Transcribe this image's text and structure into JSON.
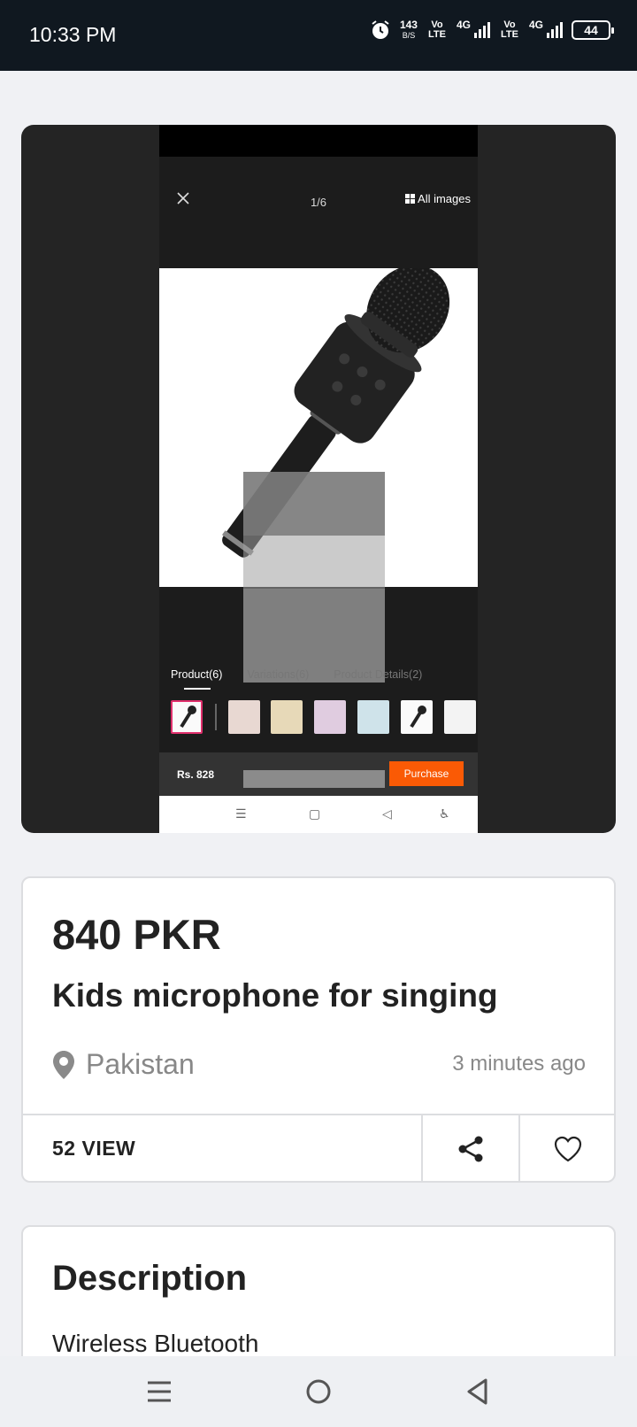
{
  "status_bar": {
    "time": "10:33 PM",
    "net_speed": "143",
    "net_speed_unit": "B/S",
    "volte1": "Vo LTE",
    "volte2": "Vo LTE",
    "net1": "4G",
    "net2": "4G",
    "battery": "44"
  },
  "viewer": {
    "counter": "1/6",
    "all_images": "All images",
    "tabs": [
      "Product(6)",
      "Variations(6)",
      "Product Details(2)"
    ],
    "price": "Rs. 828",
    "purchase": "Purchase"
  },
  "product": {
    "price": "840 PKR",
    "title": "Kids microphone for singing",
    "location": "Pakistan",
    "posted": "3 minutes ago",
    "views": "52 VIEW"
  },
  "description": {
    "heading": "Description",
    "text": "Wireless Bluetooth"
  },
  "colors": {
    "accent": "#fa5a05",
    "selected_thumb": "#e0306d",
    "status_bar": "#101820"
  }
}
